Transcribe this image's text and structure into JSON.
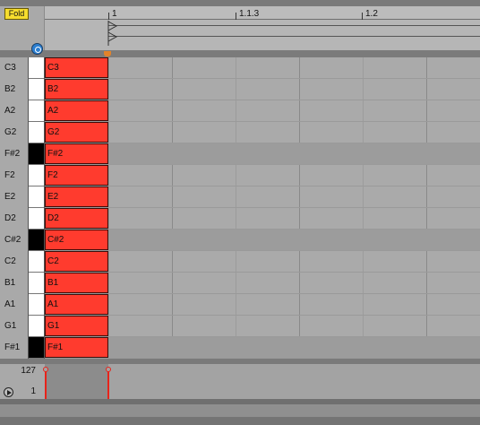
{
  "header": {
    "fold_label": "Fold",
    "ruler_labels": [
      "1",
      "1.1.3",
      "1.2"
    ]
  },
  "notes": [
    {
      "name": "C3",
      "black": false,
      "shaded": false
    },
    {
      "name": "B2",
      "black": false,
      "shaded": false
    },
    {
      "name": "A2",
      "black": false,
      "shaded": false
    },
    {
      "name": "G2",
      "black": false,
      "shaded": false
    },
    {
      "name": "F#2",
      "black": true,
      "shaded": true
    },
    {
      "name": "F2",
      "black": false,
      "shaded": false
    },
    {
      "name": "E2",
      "black": false,
      "shaded": false
    },
    {
      "name": "D2",
      "black": false,
      "shaded": false
    },
    {
      "name": "C#2",
      "black": true,
      "shaded": true
    },
    {
      "name": "C2",
      "black": false,
      "shaded": false
    },
    {
      "name": "B1",
      "black": false,
      "shaded": false
    },
    {
      "name": "A1",
      "black": false,
      "shaded": false
    },
    {
      "name": "G1",
      "black": false,
      "shaded": false
    },
    {
      "name": "F#1",
      "black": true,
      "shaded": true
    }
  ],
  "velocity": {
    "max_label": "127",
    "min_label": "1"
  },
  "colors": {
    "note_fill": "#ff3b2e",
    "fold_button": "#f6dd2e",
    "playhead": "#e2832b",
    "velocity_stem": "#e8231a"
  }
}
